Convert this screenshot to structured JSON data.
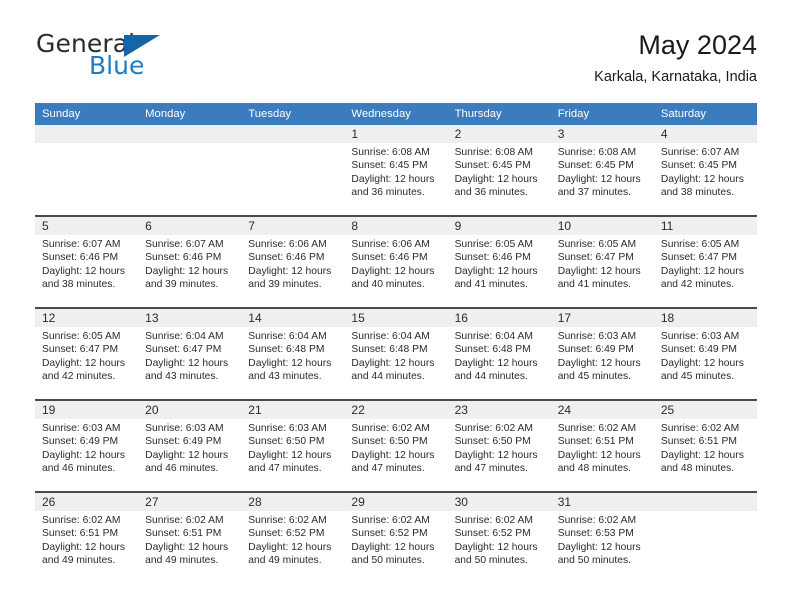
{
  "brand": {
    "name_part1": "General",
    "name_part2": "Blue",
    "logo_color": "#1565a8",
    "accent_color": "#1c7cc4"
  },
  "header": {
    "title": "May 2024",
    "subtitle": "Karkala, Karnataka, India"
  },
  "theme": {
    "header_row_bg": "#3a7cbe",
    "header_row_text": "#ffffff",
    "daynum_band_bg": "#efefef",
    "row_separator": "#4a4a4a",
    "body_text": "#2b2b2b"
  },
  "weekday_headers": [
    "Sunday",
    "Monday",
    "Tuesday",
    "Wednesday",
    "Thursday",
    "Friday",
    "Saturday"
  ],
  "labels": {
    "sunrise_prefix": "Sunrise:",
    "sunset_prefix": "Sunset:",
    "daylight_prefix": "Daylight:"
  },
  "weeks": [
    [
      {
        "day": "",
        "sunrise": "",
        "sunset": "",
        "daylight_line1": "",
        "daylight_line2": ""
      },
      {
        "day": "",
        "sunrise": "",
        "sunset": "",
        "daylight_line1": "",
        "daylight_line2": ""
      },
      {
        "day": "",
        "sunrise": "",
        "sunset": "",
        "daylight_line1": "",
        "daylight_line2": ""
      },
      {
        "day": "1",
        "sunrise": "Sunrise: 6:08 AM",
        "sunset": "Sunset: 6:45 PM",
        "daylight_line1": "Daylight: 12 hours",
        "daylight_line2": "and 36 minutes."
      },
      {
        "day": "2",
        "sunrise": "Sunrise: 6:08 AM",
        "sunset": "Sunset: 6:45 PM",
        "daylight_line1": "Daylight: 12 hours",
        "daylight_line2": "and 36 minutes."
      },
      {
        "day": "3",
        "sunrise": "Sunrise: 6:08 AM",
        "sunset": "Sunset: 6:45 PM",
        "daylight_line1": "Daylight: 12 hours",
        "daylight_line2": "and 37 minutes."
      },
      {
        "day": "4",
        "sunrise": "Sunrise: 6:07 AM",
        "sunset": "Sunset: 6:45 PM",
        "daylight_line1": "Daylight: 12 hours",
        "daylight_line2": "and 38 minutes."
      }
    ],
    [
      {
        "day": "5",
        "sunrise": "Sunrise: 6:07 AM",
        "sunset": "Sunset: 6:46 PM",
        "daylight_line1": "Daylight: 12 hours",
        "daylight_line2": "and 38 minutes."
      },
      {
        "day": "6",
        "sunrise": "Sunrise: 6:07 AM",
        "sunset": "Sunset: 6:46 PM",
        "daylight_line1": "Daylight: 12 hours",
        "daylight_line2": "and 39 minutes."
      },
      {
        "day": "7",
        "sunrise": "Sunrise: 6:06 AM",
        "sunset": "Sunset: 6:46 PM",
        "daylight_line1": "Daylight: 12 hours",
        "daylight_line2": "and 39 minutes."
      },
      {
        "day": "8",
        "sunrise": "Sunrise: 6:06 AM",
        "sunset": "Sunset: 6:46 PM",
        "daylight_line1": "Daylight: 12 hours",
        "daylight_line2": "and 40 minutes."
      },
      {
        "day": "9",
        "sunrise": "Sunrise: 6:05 AM",
        "sunset": "Sunset: 6:46 PM",
        "daylight_line1": "Daylight: 12 hours",
        "daylight_line2": "and 41 minutes."
      },
      {
        "day": "10",
        "sunrise": "Sunrise: 6:05 AM",
        "sunset": "Sunset: 6:47 PM",
        "daylight_line1": "Daylight: 12 hours",
        "daylight_line2": "and 41 minutes."
      },
      {
        "day": "11",
        "sunrise": "Sunrise: 6:05 AM",
        "sunset": "Sunset: 6:47 PM",
        "daylight_line1": "Daylight: 12 hours",
        "daylight_line2": "and 42 minutes."
      }
    ],
    [
      {
        "day": "12",
        "sunrise": "Sunrise: 6:05 AM",
        "sunset": "Sunset: 6:47 PM",
        "daylight_line1": "Daylight: 12 hours",
        "daylight_line2": "and 42 minutes."
      },
      {
        "day": "13",
        "sunrise": "Sunrise: 6:04 AM",
        "sunset": "Sunset: 6:47 PM",
        "daylight_line1": "Daylight: 12 hours",
        "daylight_line2": "and 43 minutes."
      },
      {
        "day": "14",
        "sunrise": "Sunrise: 6:04 AM",
        "sunset": "Sunset: 6:48 PM",
        "daylight_line1": "Daylight: 12 hours",
        "daylight_line2": "and 43 minutes."
      },
      {
        "day": "15",
        "sunrise": "Sunrise: 6:04 AM",
        "sunset": "Sunset: 6:48 PM",
        "daylight_line1": "Daylight: 12 hours",
        "daylight_line2": "and 44 minutes."
      },
      {
        "day": "16",
        "sunrise": "Sunrise: 6:04 AM",
        "sunset": "Sunset: 6:48 PM",
        "daylight_line1": "Daylight: 12 hours",
        "daylight_line2": "and 44 minutes."
      },
      {
        "day": "17",
        "sunrise": "Sunrise: 6:03 AM",
        "sunset": "Sunset: 6:49 PM",
        "daylight_line1": "Daylight: 12 hours",
        "daylight_line2": "and 45 minutes."
      },
      {
        "day": "18",
        "sunrise": "Sunrise: 6:03 AM",
        "sunset": "Sunset: 6:49 PM",
        "daylight_line1": "Daylight: 12 hours",
        "daylight_line2": "and 45 minutes."
      }
    ],
    [
      {
        "day": "19",
        "sunrise": "Sunrise: 6:03 AM",
        "sunset": "Sunset: 6:49 PM",
        "daylight_line1": "Daylight: 12 hours",
        "daylight_line2": "and 46 minutes."
      },
      {
        "day": "20",
        "sunrise": "Sunrise: 6:03 AM",
        "sunset": "Sunset: 6:49 PM",
        "daylight_line1": "Daylight: 12 hours",
        "daylight_line2": "and 46 minutes."
      },
      {
        "day": "21",
        "sunrise": "Sunrise: 6:03 AM",
        "sunset": "Sunset: 6:50 PM",
        "daylight_line1": "Daylight: 12 hours",
        "daylight_line2": "and 47 minutes."
      },
      {
        "day": "22",
        "sunrise": "Sunrise: 6:02 AM",
        "sunset": "Sunset: 6:50 PM",
        "daylight_line1": "Daylight: 12 hours",
        "daylight_line2": "and 47 minutes."
      },
      {
        "day": "23",
        "sunrise": "Sunrise: 6:02 AM",
        "sunset": "Sunset: 6:50 PM",
        "daylight_line1": "Daylight: 12 hours",
        "daylight_line2": "and 47 minutes."
      },
      {
        "day": "24",
        "sunrise": "Sunrise: 6:02 AM",
        "sunset": "Sunset: 6:51 PM",
        "daylight_line1": "Daylight: 12 hours",
        "daylight_line2": "and 48 minutes."
      },
      {
        "day": "25",
        "sunrise": "Sunrise: 6:02 AM",
        "sunset": "Sunset: 6:51 PM",
        "daylight_line1": "Daylight: 12 hours",
        "daylight_line2": "and 48 minutes."
      }
    ],
    [
      {
        "day": "26",
        "sunrise": "Sunrise: 6:02 AM",
        "sunset": "Sunset: 6:51 PM",
        "daylight_line1": "Daylight: 12 hours",
        "daylight_line2": "and 49 minutes."
      },
      {
        "day": "27",
        "sunrise": "Sunrise: 6:02 AM",
        "sunset": "Sunset: 6:51 PM",
        "daylight_line1": "Daylight: 12 hours",
        "daylight_line2": "and 49 minutes."
      },
      {
        "day": "28",
        "sunrise": "Sunrise: 6:02 AM",
        "sunset": "Sunset: 6:52 PM",
        "daylight_line1": "Daylight: 12 hours",
        "daylight_line2": "and 49 minutes."
      },
      {
        "day": "29",
        "sunrise": "Sunrise: 6:02 AM",
        "sunset": "Sunset: 6:52 PM",
        "daylight_line1": "Daylight: 12 hours",
        "daylight_line2": "and 50 minutes."
      },
      {
        "day": "30",
        "sunrise": "Sunrise: 6:02 AM",
        "sunset": "Sunset: 6:52 PM",
        "daylight_line1": "Daylight: 12 hours",
        "daylight_line2": "and 50 minutes."
      },
      {
        "day": "31",
        "sunrise": "Sunrise: 6:02 AM",
        "sunset": "Sunset: 6:53 PM",
        "daylight_line1": "Daylight: 12 hours",
        "daylight_line2": "and 50 minutes."
      },
      {
        "day": "",
        "sunrise": "",
        "sunset": "",
        "daylight_line1": "",
        "daylight_line2": ""
      }
    ]
  ]
}
